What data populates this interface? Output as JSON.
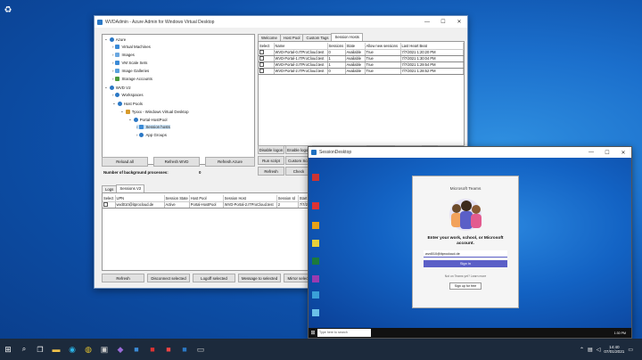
{
  "desktop": {
    "recycle_label": "Recycle Bin"
  },
  "wvd": {
    "title": "WVDAdmin - Azure Admin for Windows Virtual Desktop",
    "tree": [
      {
        "label": "Azure"
      },
      {
        "label": "Virtual Machines"
      },
      {
        "label": "Images"
      },
      {
        "label": "VM Scale Sets"
      },
      {
        "label": "Image Galleries"
      },
      {
        "label": "Storage Accounts"
      },
      {
        "label": "WVD V2"
      },
      {
        "label": "Workspaces"
      },
      {
        "label": "Host Pools"
      },
      {
        "label": "Tyxxx - Windows Virtual Desktop"
      },
      {
        "label": "Portal-HostPool"
      },
      {
        "label": "Session hosts"
      },
      {
        "label": "App Groups"
      }
    ],
    "buttons": {
      "reload": "Reload all",
      "refresh_wvd": "Refresh WVD",
      "refresh_azure": "Refresh Azure"
    },
    "bg_label": "Number of background processes:",
    "bg_count": "0",
    "right_tabs": [
      "Welcome",
      "Host Pool",
      "Custom Tags",
      "Session Hosts"
    ],
    "hosts_headers": [
      "Select",
      "Name",
      "Sessions",
      "State",
      "Allow new sessions",
      "Last Heart Beat"
    ],
    "hosts_rows": [
      {
        "name": "WVD-Portal-0.ITProCloud.test",
        "sessions": "0",
        "state": "Available",
        "allow": "True",
        "beat": "7/7/2021 1:20:20 PM"
      },
      {
        "name": "WVD-Portal-1.ITProCloud.test",
        "sessions": "1",
        "state": "Available",
        "allow": "True",
        "beat": "7/7/2021 1:30:04 PM"
      },
      {
        "name": "WVD-Portal-3.ITProCloud.test",
        "sessions": "1",
        "state": "Available",
        "allow": "True",
        "beat": "7/7/2021 1:29:54 PM"
      },
      {
        "name": "WVD-Portal-2.ITProCloud.test",
        "sessions": "0",
        "state": "Available",
        "allow": "True",
        "beat": "7/7/2021 1:28:52 PM"
      }
    ],
    "host_buttons": {
      "disable": "Disable logon",
      "enable": "Enable logon",
      "run": "Run script",
      "custom": "Custom Scri",
      "refresh": "Refresh",
      "check": "Check"
    },
    "bottom_tabs": [
      "Logs",
      "Sessions V2"
    ],
    "sess_headers": [
      "Select",
      "UPN",
      "Session State",
      "Host Pool",
      "Session Host",
      "Session Id",
      "Start Ti"
    ],
    "sess_rows": [
      {
        "upn": "wvd010@itprocloud.de",
        "state": "Active",
        "pool": "Portal-HostPool",
        "host": "WVD-Portal-2.ITProCloud.test",
        "id": "2",
        "start": "7/7/2021"
      }
    ],
    "bottom_buttons": {
      "refresh": "Refresh",
      "disconnect": "Disconnect selected",
      "logoff": "Logoff selected",
      "message": "Message to selected",
      "shadow": "Mirror selected"
    }
  },
  "session": {
    "title": "SessionDesktop",
    "teams_title": "Microsoft Teams",
    "teams_prompt": "Enter your work, school, or Microsoft account.",
    "email_value": "wvd010@itprocloud.de",
    "signin": "Sign in",
    "no_account": "Not on Teams yet? Learn more",
    "signup": "Sign up for free",
    "search_placeholder": "Type here to search",
    "inner_clock": "1:30 PM"
  },
  "taskbar": {
    "time": "14:40",
    "date": "07/01/2021",
    "colors": {
      "accent": "#2b78c5",
      "teams": "#5b5fc7"
    }
  }
}
